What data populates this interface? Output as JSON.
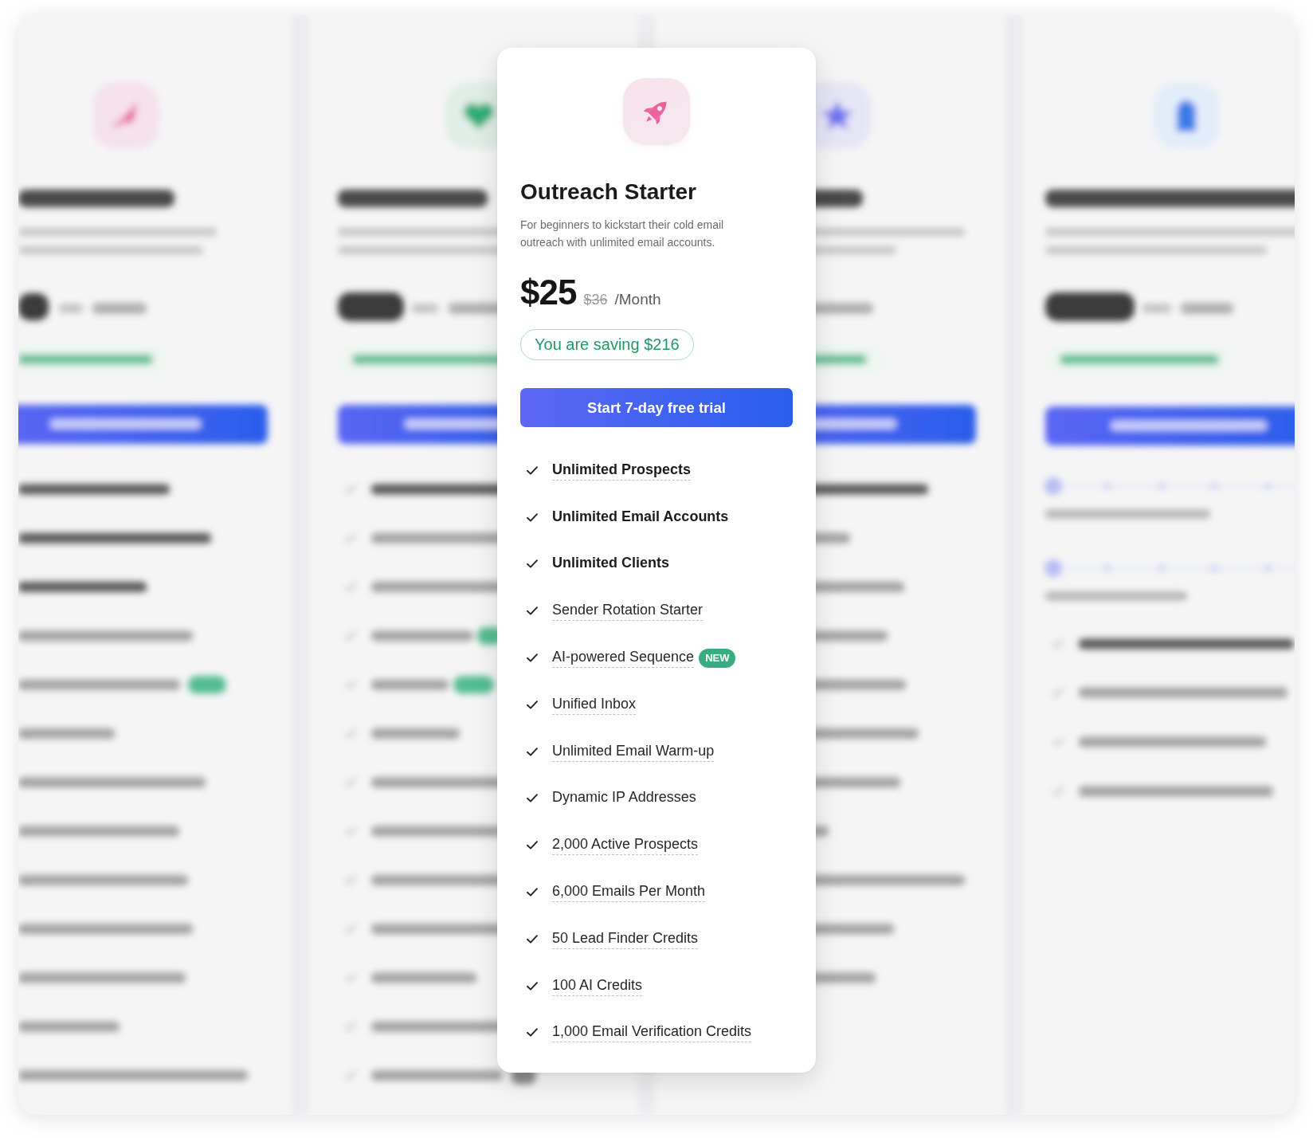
{
  "plan": {
    "name": "Outreach Starter",
    "description": "For beginners to kickstart their cold email outreach with unlimited email accounts.",
    "price": "$25",
    "original_price": "$36",
    "period": "/Month",
    "saving": "You are saving $216",
    "cta": "Start 7-day free trial"
  },
  "features": [
    {
      "label": "Unlimited Prospects",
      "bold": true,
      "underlined": true
    },
    {
      "label": "Unlimited Email Accounts",
      "bold": true,
      "underlined": false
    },
    {
      "label": "Unlimited Clients",
      "bold": true,
      "underlined": false
    },
    {
      "label": "Sender Rotation Starter",
      "bold": false,
      "underlined": true
    },
    {
      "label": "AI-powered Sequence",
      "bold": false,
      "underlined": true,
      "badge": "NEW"
    },
    {
      "label": "Unified Inbox",
      "bold": false,
      "underlined": true
    },
    {
      "label": "Unlimited Email Warm-up",
      "bold": false,
      "underlined": true
    },
    {
      "label": "Dynamic IP Addresses",
      "bold": false,
      "underlined": false
    },
    {
      "label": "2,000 Active Prospects",
      "bold": false,
      "underlined": true
    },
    {
      "label": "6,000 Emails Per Month",
      "bold": false,
      "underlined": true
    },
    {
      "label": "50 Lead Finder Credits",
      "bold": false,
      "underlined": true
    },
    {
      "label": "100 AI Credits",
      "bold": false,
      "underlined": true
    },
    {
      "label": "1,000 Email Verification Credits",
      "bold": false,
      "underlined": true
    }
  ]
}
